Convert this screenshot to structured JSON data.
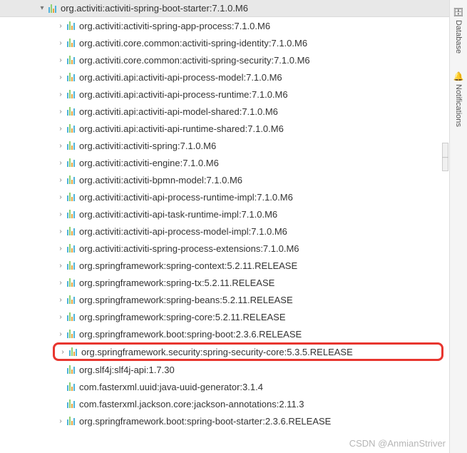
{
  "rootNode": {
    "label": "org.activiti:activiti-spring-boot-starter:7.1.0.M6",
    "expanded": true
  },
  "children": [
    {
      "label": "org.activiti:activiti-spring-app-process:7.1.0.M6",
      "hasChevron": true
    },
    {
      "label": "org.activiti.core.common:activiti-spring-identity:7.1.0.M6",
      "hasChevron": true
    },
    {
      "label": "org.activiti.core.common:activiti-spring-security:7.1.0.M6",
      "hasChevron": true
    },
    {
      "label": "org.activiti.api:activiti-api-process-model:7.1.0.M6",
      "hasChevron": true
    },
    {
      "label": "org.activiti.api:activiti-api-process-runtime:7.1.0.M6",
      "hasChevron": true
    },
    {
      "label": "org.activiti.api:activiti-api-model-shared:7.1.0.M6",
      "hasChevron": true
    },
    {
      "label": "org.activiti.api:activiti-api-runtime-shared:7.1.0.M6",
      "hasChevron": true
    },
    {
      "label": "org.activiti:activiti-spring:7.1.0.M6",
      "hasChevron": true
    },
    {
      "label": "org.activiti:activiti-engine:7.1.0.M6",
      "hasChevron": true
    },
    {
      "label": "org.activiti:activiti-bpmn-model:7.1.0.M6",
      "hasChevron": true
    },
    {
      "label": "org.activiti:activiti-api-process-runtime-impl:7.1.0.M6",
      "hasChevron": true
    },
    {
      "label": "org.activiti:activiti-api-task-runtime-impl:7.1.0.M6",
      "hasChevron": true
    },
    {
      "label": "org.activiti:activiti-api-process-model-impl:7.1.0.M6",
      "hasChevron": true
    },
    {
      "label": "org.activiti:activiti-spring-process-extensions:7.1.0.M6",
      "hasChevron": true
    },
    {
      "label": "org.springframework:spring-context:5.2.11.RELEASE",
      "hasChevron": true
    },
    {
      "label": "org.springframework:spring-tx:5.2.11.RELEASE",
      "hasChevron": true
    },
    {
      "label": "org.springframework:spring-beans:5.2.11.RELEASE",
      "hasChevron": true
    },
    {
      "label": "org.springframework:spring-core:5.2.11.RELEASE",
      "hasChevron": true
    },
    {
      "label": "org.springframework.boot:spring-boot:2.3.6.RELEASE",
      "hasChevron": true
    },
    {
      "label": "org.springframework.security:spring-security-core:5.3.5.RELEASE",
      "hasChevron": true,
      "highlighted": true
    },
    {
      "label": "org.slf4j:slf4j-api:1.7.30",
      "hasChevron": false
    },
    {
      "label": "com.fasterxml.uuid:java-uuid-generator:3.1.4",
      "hasChevron": false
    },
    {
      "label": "com.fasterxml.jackson.core:jackson-annotations:2.11.3",
      "hasChevron": false
    },
    {
      "label": "org.springframework.boot:spring-boot-starter:2.3.6.RELEASE",
      "hasChevron": true
    }
  ],
  "sidebarTabs": [
    {
      "icon": "🗄",
      "label": "Database"
    },
    {
      "icon": "🔔",
      "label": "Notifications"
    }
  ],
  "watermark": "CSDN @AnmianStriver"
}
